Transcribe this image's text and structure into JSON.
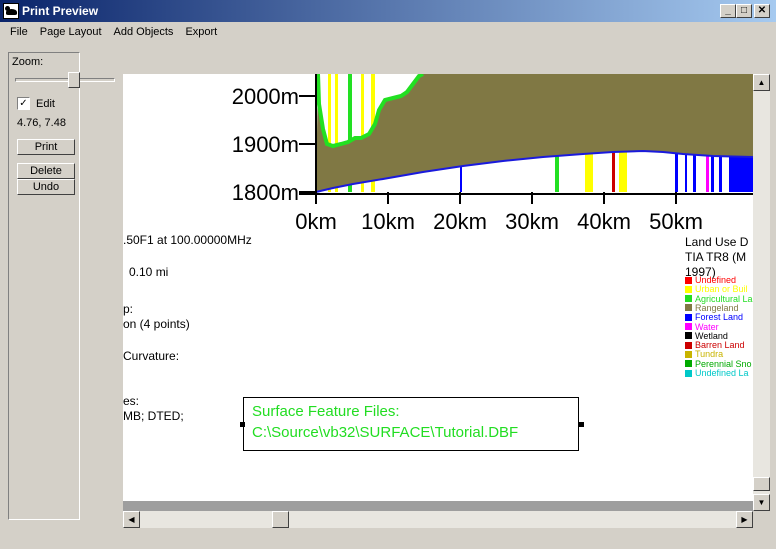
{
  "window": {
    "title": "Print Preview",
    "controls": {
      "minimize": "_",
      "maximize": "□",
      "close": "✕"
    }
  },
  "menu": [
    "File",
    "Page Layout",
    "Add Objects",
    "Export"
  ],
  "left_panel": {
    "zoom_label": "Zoom:",
    "zoom_fraction": 0.55,
    "edit_label": "Edit",
    "edit_checked": true,
    "check_mark": "✓",
    "coords": "4.76, 7.48",
    "print_label": "Print",
    "delete_label": "Delete",
    "undo_label": "Undo"
  },
  "profile_chart": {
    "y_ticks": [
      "2000m",
      "1900m",
      "1800m"
    ],
    "x_ticks": [
      "0km",
      "10km",
      "20km",
      "30km",
      "40km",
      "50km"
    ],
    "colors": {
      "rangeland": "#807844",
      "green_line": "#22e022",
      "blue_line": "#1a1adc",
      "yellow": "#ffff00",
      "blue": "#0000ff",
      "red": "#cc0000",
      "magenta": "#ff00ff"
    }
  },
  "info_text": {
    "freq": ".50F1 at 100.00000MHz",
    "distance": "0.10 mi",
    "p_line": "p:",
    "points": "on (4 points)",
    "curvature": "Curvature:",
    "files_line": "es:",
    "mb_line": "MB; DTED;"
  },
  "legend": {
    "title": [
      "Land Use D",
      "TIA TR8 (M",
      "1997)"
    ],
    "items": [
      {
        "label": "Undefined",
        "color": "#ff0000"
      },
      {
        "label": "Urban or Buil",
        "color": "#ffff00"
      },
      {
        "label": "Agricultural La",
        "color": "#22dd22"
      },
      {
        "label": "Rangeland",
        "color": "#807844"
      },
      {
        "label": "Forest Land",
        "color": "#0000ff"
      },
      {
        "label": "Water",
        "color": "#ff00ff"
      },
      {
        "label": "Wetland",
        "color": "#000000"
      },
      {
        "label": "Barren Land",
        "color": "#cc0000"
      },
      {
        "label": "Tundra",
        "color": "#c8b400"
      },
      {
        "label": "Perennial Sno",
        "color": "#00aa00"
      },
      {
        "label": "Undefined La",
        "color": "#00c8c8"
      }
    ]
  },
  "surface_box": {
    "line1": "Surface Feature Files:",
    "line2": "C:\\Source\\vb32\\SURFACE\\Tutorial.DBF",
    "color": "#22dd22"
  },
  "scrollbars": {
    "up": "▲",
    "down": "▼",
    "left": "◀",
    "right": "▶"
  }
}
